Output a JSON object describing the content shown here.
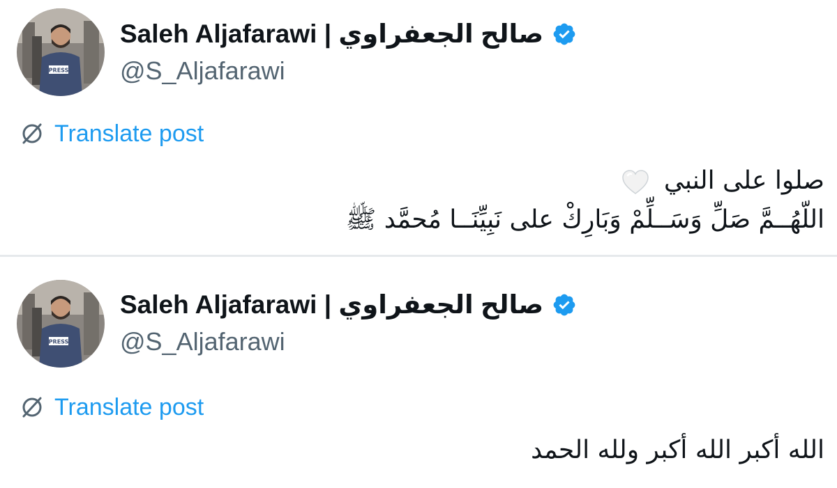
{
  "posts": [
    {
      "author": {
        "display_name": "Saleh Aljafarawi | صالح الجعفراوي",
        "handle": "@S_Aljafarawi",
        "verified": true,
        "vest_text": "PRESS"
      },
      "translate_label": "Translate post",
      "text_lines": [
        "صلوا على النبي",
        "اللّهُــمَّ صَلِّ وَسَــلِّمْ وَبَارِكْ على نَبِيِّنَــا مُحمَّد ﷺ"
      ],
      "emoji": "white-heart"
    },
    {
      "author": {
        "display_name": "Saleh Aljafarawi | صالح الجعفراوي",
        "handle": "@S_Aljafarawi",
        "verified": true,
        "vest_text": "PRESS"
      },
      "translate_label": "Translate post",
      "text_lines": [
        "الله أكبر الله أكبر ولله الحمد"
      ]
    }
  ],
  "colors": {
    "verified": "#1d9bf0",
    "link": "#1d9bf0",
    "handle": "#536471",
    "text": "#0f1419",
    "divider": "#e6e9ec"
  }
}
